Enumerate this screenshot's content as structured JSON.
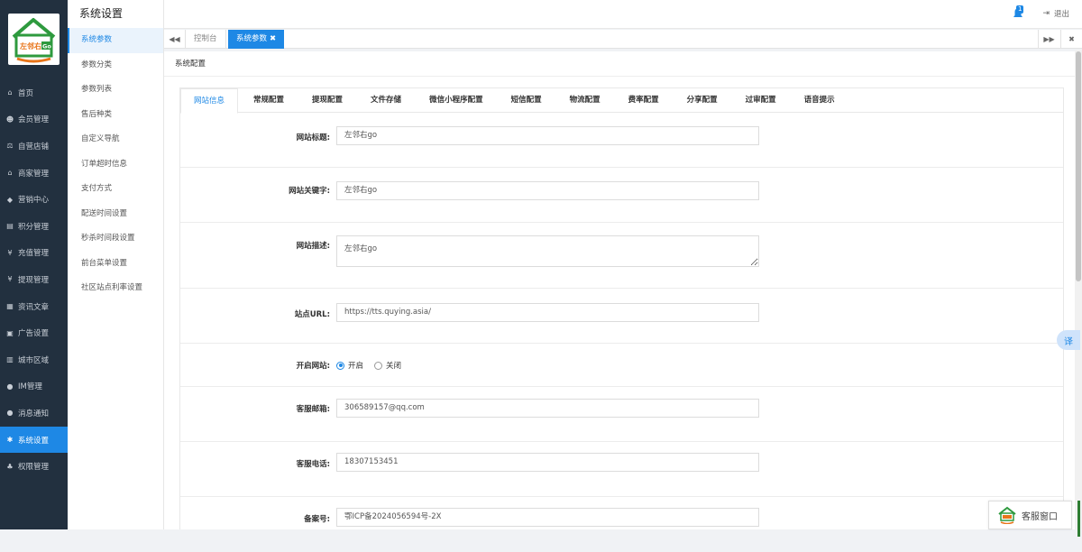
{
  "brand": {
    "logo_text": "左邻右Go",
    "colors": {
      "green": "#2e9a3e",
      "orange": "#e8751a",
      "accent": "#1e88e5",
      "sidebar_bg": "#22303f"
    }
  },
  "nav": [
    {
      "icon": "home-icon",
      "glyph": "⌂",
      "label": "首页"
    },
    {
      "icon": "users-icon",
      "glyph": "☻",
      "label": "会员管理"
    },
    {
      "icon": "scale-icon",
      "glyph": "⚖",
      "label": "自营店铺"
    },
    {
      "icon": "bank-icon",
      "glyph": "⌂",
      "label": "商家管理"
    },
    {
      "icon": "tag-icon",
      "glyph": "◆",
      "label": "营销中心"
    },
    {
      "icon": "file-icon",
      "glyph": "▤",
      "label": "积分管理"
    },
    {
      "icon": "yen-icon",
      "glyph": "¥",
      "label": "充值管理"
    },
    {
      "icon": "yen-icon",
      "glyph": "¥",
      "label": "提现管理"
    },
    {
      "icon": "newspaper-icon",
      "glyph": "▦",
      "label": "资讯文章"
    },
    {
      "icon": "image-icon",
      "glyph": "▣",
      "label": "广告设置"
    },
    {
      "icon": "map-icon",
      "glyph": "▥",
      "label": "城市区域"
    },
    {
      "icon": "chat-icon",
      "glyph": "●",
      "label": "IM管理"
    },
    {
      "icon": "comment-icon",
      "glyph": "●",
      "label": "消息通知"
    },
    {
      "icon": "gear-icon",
      "glyph": "✱",
      "label": "系统设置",
      "active": true
    },
    {
      "icon": "sitemap-icon",
      "glyph": "♣",
      "label": "权限管理"
    }
  ],
  "subnav": {
    "title": "系统设置",
    "items": [
      {
        "label": "系统参数",
        "active": true
      },
      {
        "label": "参数分类"
      },
      {
        "label": "参数列表"
      },
      {
        "label": "售后种类"
      },
      {
        "label": "自定义导航"
      },
      {
        "label": "订单超时信息"
      },
      {
        "label": "支付方式"
      },
      {
        "label": "配送时间设置"
      },
      {
        "label": "秒杀时间段设置"
      },
      {
        "label": "前台菜单设置"
      },
      {
        "label": "社区站点利率设置"
      }
    ]
  },
  "header": {
    "notification_count": "1",
    "logout_label": "退出"
  },
  "tabbar": {
    "home_tab": "控制台",
    "current_tab": "系统参数",
    "close_glyph": "✖"
  },
  "panel": {
    "title": "系统配置"
  },
  "form_tabs": [
    "网站信息",
    "常规配置",
    "提现配置",
    "文件存储",
    "微信小程序配置",
    "短信配置",
    "物流配置",
    "费率配置",
    "分享配置",
    "过审配置",
    "语音提示"
  ],
  "fields": {
    "site_title": {
      "label": "网站标题:",
      "value": "左邻右go"
    },
    "site_keywords": {
      "label": "网站关键字:",
      "value": "左邻右go"
    },
    "site_desc": {
      "label": "网站描述:",
      "value": "左邻右go"
    },
    "site_url": {
      "label": "站点URL:",
      "value": "https://tts.quying.asia/"
    },
    "site_open": {
      "label": "开启网站:",
      "on_label": "开启",
      "off_label": "关闭",
      "selected": "开启"
    },
    "service_email": {
      "label": "客服邮箱:",
      "value": "306589157@qq.com"
    },
    "service_phone": {
      "label": "客服电话:",
      "value": "18307153451"
    },
    "icp": {
      "label": "备案号:",
      "value": "鄂ICP备2024056594号-2X"
    }
  },
  "widgets": {
    "translate_label": "译",
    "service_window_label": "客服窗口"
  }
}
